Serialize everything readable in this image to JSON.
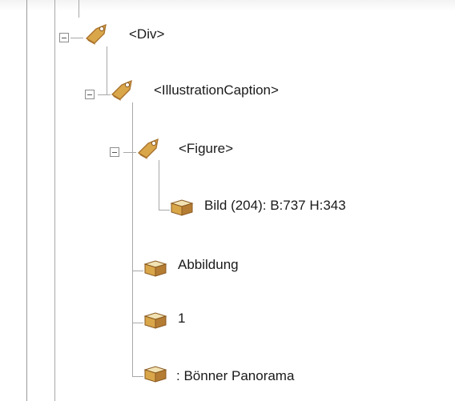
{
  "tree": {
    "nodes": [
      {
        "id": "div",
        "label": "<Div>",
        "kind": "tag",
        "expanded": true
      },
      {
        "id": "caption",
        "label": "<IllustrationCaption>",
        "kind": "tag",
        "expanded": true
      },
      {
        "id": "figure",
        "label": "<Figure>",
        "kind": "tag",
        "expanded": true
      },
      {
        "id": "bild",
        "label": "Bild (204): B:737 H:343",
        "kind": "content"
      },
      {
        "id": "abbildung",
        "label": "Abbildung",
        "kind": "content"
      },
      {
        "id": "one",
        "label": "1",
        "kind": "content"
      },
      {
        "id": "panorama",
        "label": ": Bönner Panorama",
        "kind": "content"
      }
    ]
  },
  "icons": {
    "tag": "tag-icon",
    "content": "content-box-icon",
    "toggle": "collapse-toggle-icon"
  },
  "colors": {
    "tag_fill": "#d9a64a",
    "tag_dark": "#a8702a",
    "box_fill": "#c9933e",
    "box_light": "#f1e2b3",
    "lines": "#a8a8a8"
  }
}
